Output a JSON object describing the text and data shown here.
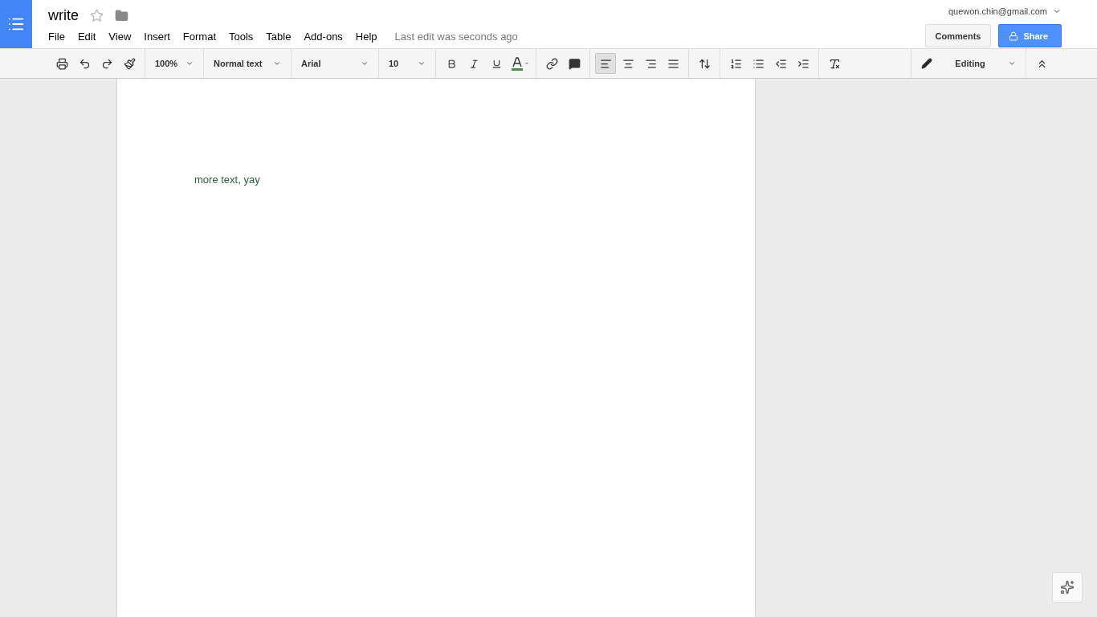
{
  "document": {
    "title": "write",
    "starred": false
  },
  "menu": [
    "File",
    "Edit",
    "View",
    "Insert",
    "Format",
    "Tools",
    "Table",
    "Add-ons",
    "Help"
  ],
  "save_status": "Last edit was seconds ago",
  "account": {
    "email": "quewon.chin@gmail.com"
  },
  "buttons": {
    "comments": "Comments",
    "share": "Share"
  },
  "toolbar": {
    "zoom": "100%",
    "style": "Normal text",
    "font": "Arial",
    "size": "10",
    "mode": "Editing",
    "alignments": [
      {
        "kind": "left",
        "selected": true
      },
      {
        "kind": "center",
        "selected": false
      },
      {
        "kind": "right",
        "selected": false
      },
      {
        "kind": "justify",
        "selected": false
      }
    ]
  },
  "body": {
    "paragraphs": [
      "more text, yay"
    ]
  }
}
